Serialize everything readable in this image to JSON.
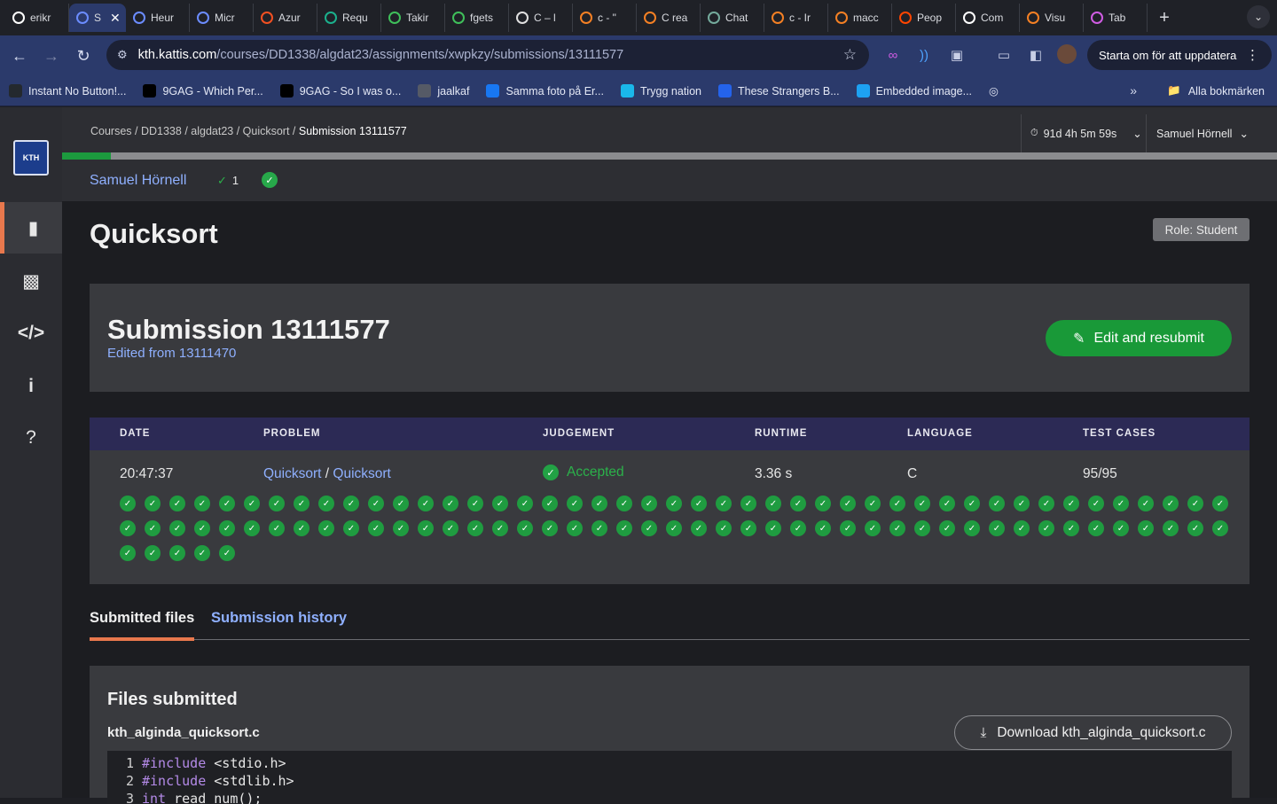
{
  "browser": {
    "tabs": [
      {
        "label": "erikr",
        "icon": "github-icon",
        "color": "#ffffff"
      },
      {
        "label": "S",
        "icon": "kth-icon",
        "color": "#6b8cff",
        "active": true
      },
      {
        "label": "Heur",
        "icon": "kth-icon",
        "color": "#6b8cff"
      },
      {
        "label": "Micr",
        "icon": "kth-icon",
        "color": "#6b8cff"
      },
      {
        "label": "Azur",
        "icon": "microsoft-icon",
        "color": "#f25022"
      },
      {
        "label": "Requ",
        "icon": "requ-icon",
        "color": "#1bb08c"
      },
      {
        "label": "Takir",
        "icon": "infinity-icon",
        "color": "#3fbf5a"
      },
      {
        "label": "fgets",
        "icon": "infinity-icon",
        "color": "#3fbf5a"
      },
      {
        "label": "C – l",
        "icon": "c-icon",
        "color": "#e0e0e0"
      },
      {
        "label": "c - \"",
        "icon": "stack-icon",
        "color": "#f48024"
      },
      {
        "label": "C rea",
        "icon": "stack-icon",
        "color": "#f48024"
      },
      {
        "label": "Chat",
        "icon": "chatgpt-icon",
        "color": "#74aa9c"
      },
      {
        "label": "c - Ir",
        "icon": "stack-icon",
        "color": "#f48024"
      },
      {
        "label": "macc",
        "icon": "stack-icon",
        "color": "#f48024"
      },
      {
        "label": "Peop",
        "icon": "reddit-icon",
        "color": "#ff4500"
      },
      {
        "label": "Com",
        "icon": "medium-icon",
        "color": "#ffffff"
      },
      {
        "label": "Visu",
        "icon": "stack-icon",
        "color": "#f48024"
      },
      {
        "label": "Tab",
        "icon": "tab-icon",
        "color": "#d05ce3"
      }
    ],
    "url_host": "kth.kattis.com",
    "url_path": "/courses/DD1338/algdat23/assignments/xwpkzy/submissions/13111577",
    "update_label": "Starta om för att uppdatera",
    "bookmarks": [
      {
        "label": "Instant No Button!...",
        "icon": "github-icon",
        "color": "#24292e"
      },
      {
        "label": "9GAG - Which Per...",
        "icon": "9gag-icon",
        "color": "#000000"
      },
      {
        "label": "9GAG - So I was o...",
        "icon": "9gag-icon",
        "color": "#000000"
      },
      {
        "label": "jaalkaf",
        "icon": "globe-icon",
        "color": "#555a66"
      },
      {
        "label": "Samma foto på Er...",
        "icon": "facebook-icon",
        "color": "#1877f2"
      },
      {
        "label": "Trygg nation",
        "icon": "vimeo-icon",
        "color": "#1ab7ea"
      },
      {
        "label": "These Strangers B...",
        "icon": "fi-icon",
        "color": "#2463eb"
      },
      {
        "label": "Embedded image...",
        "icon": "twitter-icon",
        "color": "#1da1f2"
      }
    ],
    "all_bookmarks_label": "Alla bokmärken"
  },
  "header": {
    "breadcrumb": [
      "Courses",
      "DD1338",
      "algdat23",
      "Quicksort"
    ],
    "breadcrumb_current": "Submission 13111577",
    "timer": "91d 4h 5m 59s",
    "user_menu": "Samuel Hörnell"
  },
  "progress": {
    "fraction": 0.04
  },
  "userbar": {
    "name": "Samuel Hörnell",
    "solved_count": "1"
  },
  "page": {
    "title": "Quicksort",
    "role": "Role: Student"
  },
  "submission": {
    "title": "Submission 13111577",
    "edited_from": "Edited from 13111470",
    "edit_button": "Edit and resubmit"
  },
  "table": {
    "headers": [
      "DATE",
      "PROBLEM",
      "JUDGEMENT",
      "RUNTIME",
      "LANGUAGE",
      "TEST CASES"
    ],
    "date": "20:47:37",
    "problem_a": "Quicksort",
    "problem_sep": "/",
    "problem_b": "Quicksort",
    "judgement": "Accepted",
    "runtime": "3.36 s",
    "language": "C",
    "test_cases": "95/95",
    "passed_cases": 95
  },
  "tabs": {
    "submitted_files": "Submitted files",
    "submission_history": "Submission history"
  },
  "files": {
    "heading": "Files submitted",
    "filename": "kth_alginda_quicksort.c",
    "download_label": "Download kth_alginda_quicksort.c",
    "code_lines": [
      {
        "no": "1",
        "kw": "#include",
        "rest": " <stdio.h>"
      },
      {
        "no": "2",
        "kw": "#include",
        "rest": " <stdlib.h>"
      },
      {
        "no": "3",
        "kw": "int",
        "rest": " read_num();"
      }
    ]
  },
  "colors": {
    "accent_green": "#199938",
    "link_blue": "#8fb0ff",
    "tab_orange": "#e8784d",
    "table_header": "#2c2a55"
  }
}
